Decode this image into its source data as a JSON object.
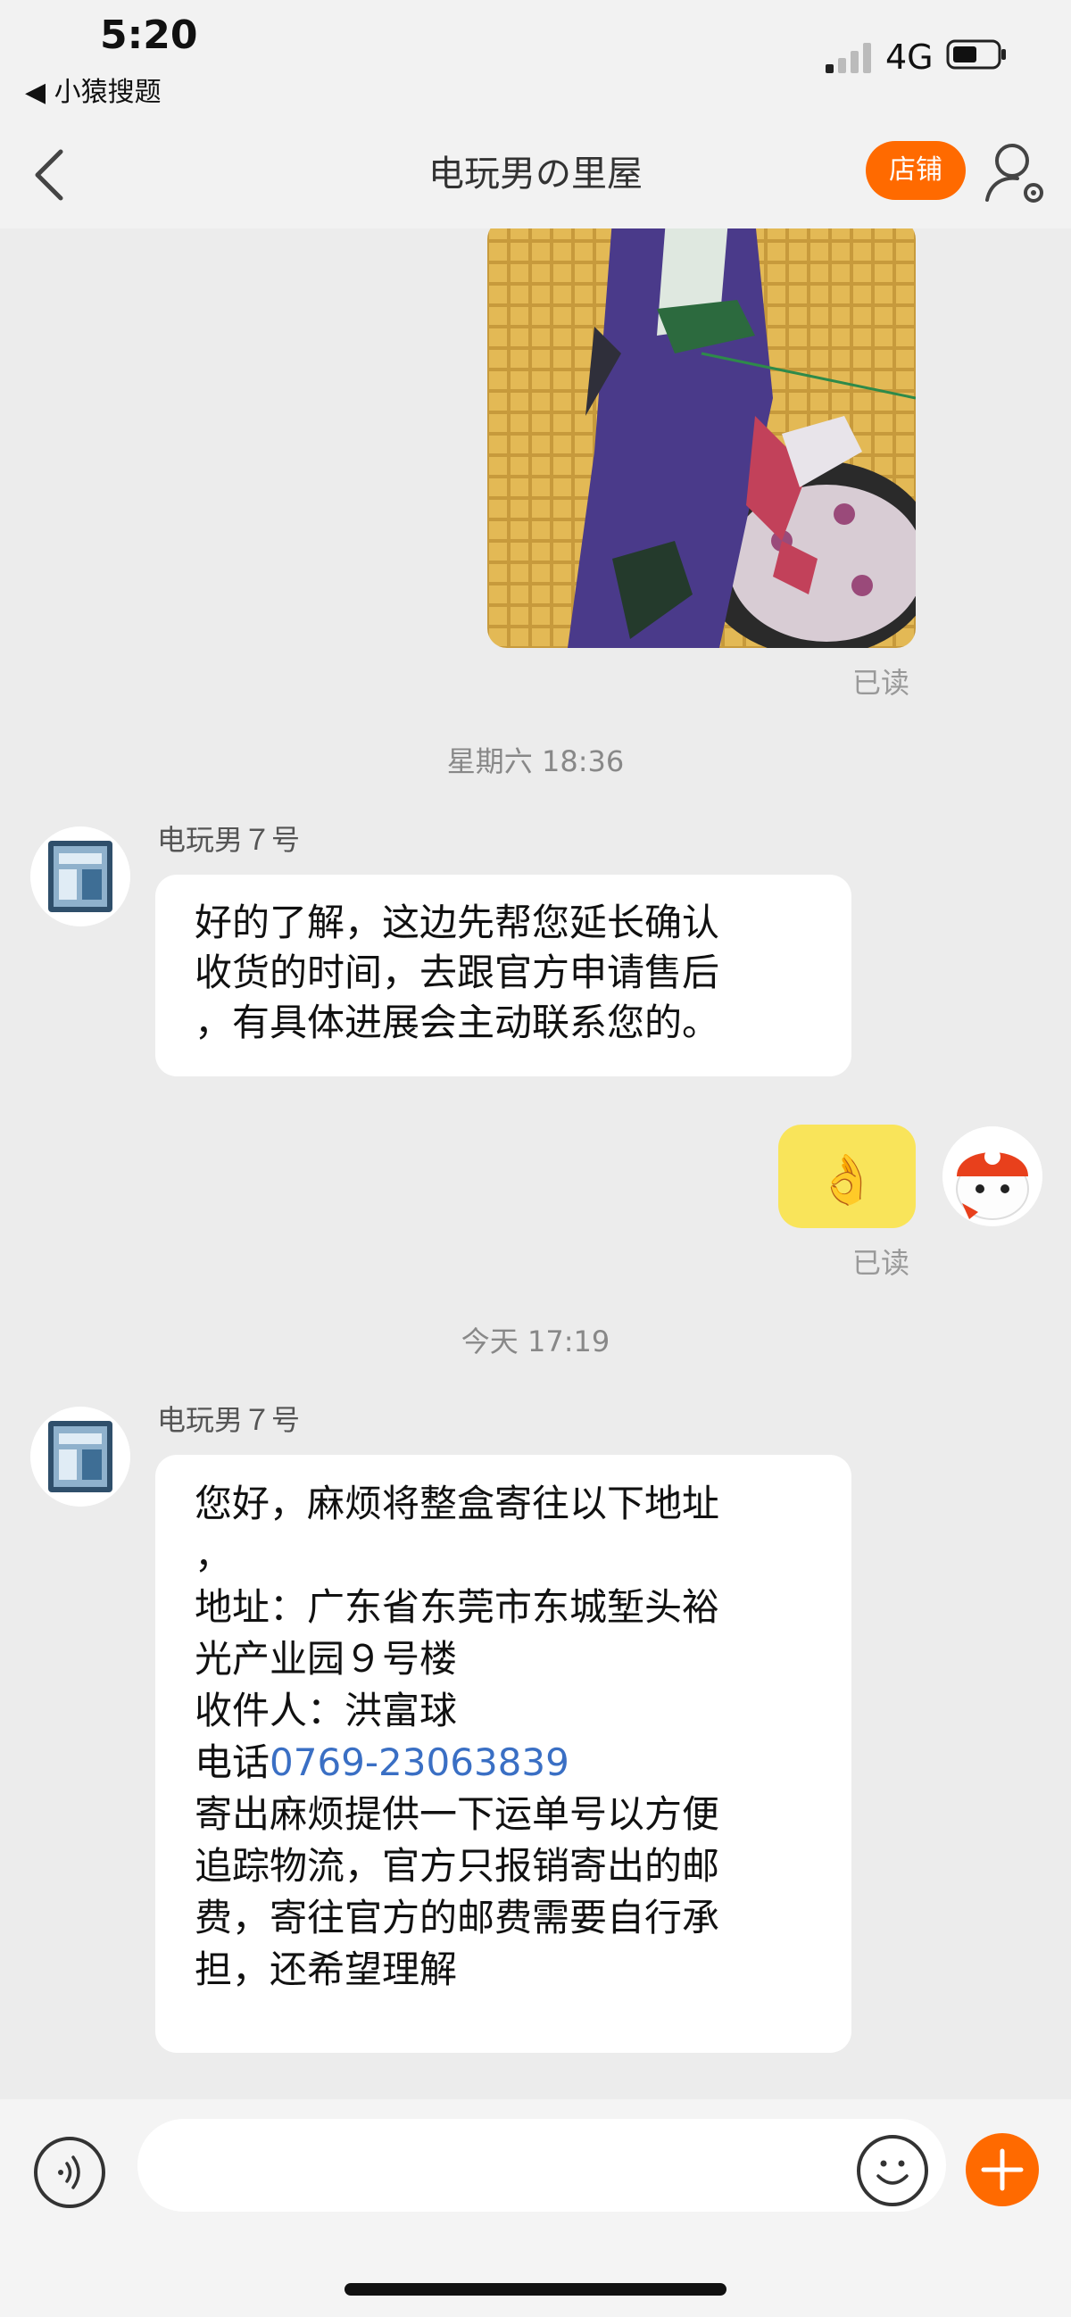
{
  "status_bar": {
    "time": "5:20",
    "back_app": "◀ 小猿搜题",
    "network": "4G"
  },
  "nav": {
    "title": "电玩男の里屋",
    "shop_label": "店铺"
  },
  "chat": {
    "image_read_status": "已读",
    "timestamp_1": "星期六 18:36",
    "message_1": {
      "sender": "电玩男７号",
      "lines": [
        "好的了解，这边先帮您延长确认",
        "收货的时间，去跟官方申请售后",
        "，有具体进展会主动联系您的。"
      ]
    },
    "my_reply": {
      "emoji": "👌",
      "read_status": "已读"
    },
    "timestamp_2": "今天 17:19",
    "message_2": {
      "sender": "电玩男７号",
      "line_1": "您好，麻烦将整盒寄往以下地址",
      "line_2": "，",
      "line_3": "地址：广东省东莞市东城堑头裕",
      "line_4": "光产业园９号楼",
      "line_5": "收件人：洪富球",
      "phone_prefix": "电话",
      "phone_number": "0769-23063839",
      "line_7": "寄出麻烦提供一下运单号以方便",
      "line_8": "追踪物流，官方只报销寄出的邮",
      "line_9": "费，寄往官方的邮费需要自行承",
      "line_10": "担，还希望理解"
    }
  },
  "input_bar": {
    "placeholder": ""
  },
  "colors": {
    "accent": "#ff6a00",
    "emoji_bubble": "#f9e45a",
    "link": "#3a6fc4",
    "background": "#ececec"
  },
  "icons": [
    "back-arrow-icon",
    "person-settings-icon",
    "voice-icon",
    "emoji-face-icon",
    "plus-icon",
    "signal-icon",
    "battery-icon"
  ]
}
